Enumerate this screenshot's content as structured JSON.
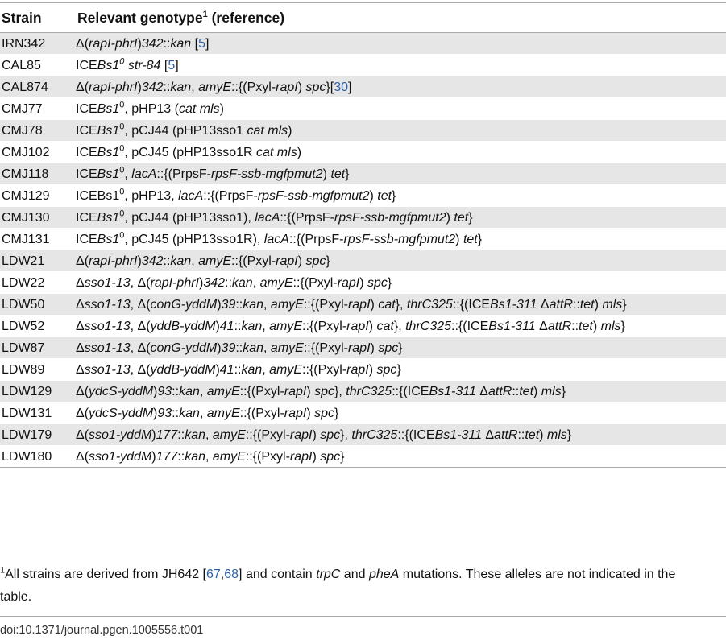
{
  "headers": {
    "strain": "Strain",
    "genotype": "Relevant genotype",
    "genotype_sup": "1",
    "genotype_suffix": "(reference)"
  },
  "rows": [
    {
      "strain": "IRN342",
      "genotype": [
        {
          "t": "Δ("
        },
        {
          "t": "rapI-phrI",
          "i": true
        },
        {
          "t": ")"
        },
        {
          "t": "342",
          "i": true
        },
        {
          "t": "::"
        },
        {
          "t": "kan",
          "i": true
        },
        {
          "t": " ["
        },
        {
          "t": "5",
          "ref": true
        },
        {
          "t": "]"
        }
      ]
    },
    {
      "strain": "CAL85",
      "genotype": [
        {
          "t": "ICE"
        },
        {
          "t": "Bs1",
          "i": true
        },
        {
          "t": "0",
          "sup": true,
          "i": true
        },
        {
          "t": " "
        },
        {
          "t": "str-84",
          "i": true
        },
        {
          "t": " ["
        },
        {
          "t": "5",
          "ref": true
        },
        {
          "t": "]"
        }
      ]
    },
    {
      "strain": "CAL874",
      "genotype": [
        {
          "t": "Δ("
        },
        {
          "t": "rapI-phrI",
          "i": true
        },
        {
          "t": ")"
        },
        {
          "t": "342",
          "i": true
        },
        {
          "t": "::"
        },
        {
          "t": "kan",
          "i": true
        },
        {
          "t": ", "
        },
        {
          "t": "amyE",
          "i": true
        },
        {
          "t": "::{(Pxyl-"
        },
        {
          "t": "rapI",
          "i": true
        },
        {
          "t": ") "
        },
        {
          "t": "spc",
          "i": true
        },
        {
          "t": "}["
        },
        {
          "t": "30",
          "ref": true
        },
        {
          "t": "]"
        }
      ]
    },
    {
      "strain": "CMJ77",
      "genotype": [
        {
          "t": "ICE"
        },
        {
          "t": "Bs1",
          "i": true
        },
        {
          "t": "0",
          "sup": true
        },
        {
          "t": ", pHP13 ("
        },
        {
          "t": "cat mls",
          "i": true
        },
        {
          "t": ")"
        }
      ]
    },
    {
      "strain": "CMJ78",
      "genotype": [
        {
          "t": "ICE"
        },
        {
          "t": "Bs1",
          "i": true
        },
        {
          "t": "0",
          "sup": true
        },
        {
          "t": ", pCJ44 (pHP13sso1 "
        },
        {
          "t": "cat mls",
          "i": true
        },
        {
          "t": ")"
        }
      ]
    },
    {
      "strain": "CMJ102",
      "genotype": [
        {
          "t": "ICE"
        },
        {
          "t": "Bs1",
          "i": true
        },
        {
          "t": "0",
          "sup": true
        },
        {
          "t": ", pCJ45 (pHP13sso1R "
        },
        {
          "t": "cat mls",
          "i": true
        },
        {
          "t": ")"
        }
      ]
    },
    {
      "strain": "CMJ118",
      "genotype": [
        {
          "t": "ICE"
        },
        {
          "t": "Bs1",
          "i": true
        },
        {
          "t": "0",
          "sup": true
        },
        {
          "t": ", "
        },
        {
          "t": "lacA",
          "i": true
        },
        {
          "t": "::{(PrpsF-"
        },
        {
          "t": "rpsF-ssb-mgfpmut2",
          "i": true
        },
        {
          "t": ") "
        },
        {
          "t": "tet",
          "i": true
        },
        {
          "t": "}"
        }
      ]
    },
    {
      "strain": "CMJ129",
      "genotype": [
        {
          "t": "ICEBs1"
        },
        {
          "t": "0",
          "sup": true
        },
        {
          "t": ", pHP13, "
        },
        {
          "t": "lacA",
          "i": true
        },
        {
          "t": "::{(PrpsF-"
        },
        {
          "t": "rpsF-ssb-mgfpmut2",
          "i": true
        },
        {
          "t": ") "
        },
        {
          "t": "tet",
          "i": true
        },
        {
          "t": "}"
        }
      ]
    },
    {
      "strain": "CMJ130",
      "genotype": [
        {
          "t": "ICE"
        },
        {
          "t": "Bs1",
          "i": true
        },
        {
          "t": "0",
          "sup": true
        },
        {
          "t": ", pCJ44 (pHP13sso1), "
        },
        {
          "t": "lacA",
          "i": true
        },
        {
          "t": "::{(PrpsF-"
        },
        {
          "t": "rpsF-ssb-mgfpmut2",
          "i": true
        },
        {
          "t": ") "
        },
        {
          "t": "tet",
          "i": true
        },
        {
          "t": "}"
        }
      ]
    },
    {
      "strain": "CMJ131",
      "genotype": [
        {
          "t": "ICE"
        },
        {
          "t": "Bs1",
          "i": true
        },
        {
          "t": "0",
          "sup": true
        },
        {
          "t": ", pCJ45 (pHP13sso1R), "
        },
        {
          "t": "lacA",
          "i": true
        },
        {
          "t": "::{(PrpsF-"
        },
        {
          "t": "rpsF-ssb-mgfpmut2",
          "i": true
        },
        {
          "t": ") "
        },
        {
          "t": "tet",
          "i": true
        },
        {
          "t": "}"
        }
      ]
    },
    {
      "strain": "LDW21",
      "genotype": [
        {
          "t": "Δ("
        },
        {
          "t": "rapI-phrI",
          "i": true
        },
        {
          "t": ")"
        },
        {
          "t": "342",
          "i": true
        },
        {
          "t": "::"
        },
        {
          "t": "kan",
          "i": true
        },
        {
          "t": ", "
        },
        {
          "t": "amyE",
          "i": true
        },
        {
          "t": "::{(Pxyl-"
        },
        {
          "t": "rapI",
          "i": true
        },
        {
          "t": ") "
        },
        {
          "t": "spc",
          "i": true
        },
        {
          "t": "}"
        }
      ]
    },
    {
      "strain": "LDW22",
      "genotype": [
        {
          "t": "Δ"
        },
        {
          "t": "sso1-13",
          "i": true
        },
        {
          "t": ", Δ("
        },
        {
          "t": "rapI-phrI",
          "i": true
        },
        {
          "t": ")"
        },
        {
          "t": "342",
          "i": true
        },
        {
          "t": "::"
        },
        {
          "t": "kan",
          "i": true
        },
        {
          "t": ", "
        },
        {
          "t": "amyE",
          "i": true
        },
        {
          "t": "::{(Pxyl-"
        },
        {
          "t": "rapI",
          "i": true
        },
        {
          "t": ") "
        },
        {
          "t": "spc",
          "i": true
        },
        {
          "t": "}"
        }
      ]
    },
    {
      "strain": "LDW50",
      "genotype": [
        {
          "t": "Δ"
        },
        {
          "t": "sso1-13",
          "i": true
        },
        {
          "t": ", Δ("
        },
        {
          "t": "conG-yddM",
          "i": true
        },
        {
          "t": ")"
        },
        {
          "t": "39",
          "i": true
        },
        {
          "t": "::"
        },
        {
          "t": "kan",
          "i": true
        },
        {
          "t": ", "
        },
        {
          "t": "amyE",
          "i": true
        },
        {
          "t": "::{(Pxyl-"
        },
        {
          "t": "rapI",
          "i": true
        },
        {
          "t": ") "
        },
        {
          "t": "cat",
          "i": true
        },
        {
          "t": "}, "
        },
        {
          "t": "thrC325",
          "i": true
        },
        {
          "t": "::{(ICE"
        },
        {
          "t": "Bs1-311",
          "i": true
        },
        {
          "t": " Δ"
        },
        {
          "t": "attR",
          "i": true
        },
        {
          "t": "::"
        },
        {
          "t": "tet",
          "i": true
        },
        {
          "t": ") "
        },
        {
          "t": "mls",
          "i": true
        },
        {
          "t": "}"
        }
      ]
    },
    {
      "strain": "LDW52",
      "genotype": [
        {
          "t": "Δ"
        },
        {
          "t": "sso1-13",
          "i": true
        },
        {
          "t": ", Δ("
        },
        {
          "t": "yddB-yddM",
          "i": true
        },
        {
          "t": ")"
        },
        {
          "t": "41",
          "i": true
        },
        {
          "t": "::"
        },
        {
          "t": "kan",
          "i": true
        },
        {
          "t": ", "
        },
        {
          "t": "amyE",
          "i": true
        },
        {
          "t": "::{(Pxyl-"
        },
        {
          "t": "rapI",
          "i": true
        },
        {
          "t": ") "
        },
        {
          "t": "cat",
          "i": true
        },
        {
          "t": "}, "
        },
        {
          "t": "thrC325",
          "i": true
        },
        {
          "t": "::{(ICE"
        },
        {
          "t": "Bs1-311",
          "i": true
        },
        {
          "t": " Δ"
        },
        {
          "t": "attR",
          "i": true
        },
        {
          "t": "::"
        },
        {
          "t": "tet",
          "i": true
        },
        {
          "t": ") "
        },
        {
          "t": "mls",
          "i": true
        },
        {
          "t": "}"
        }
      ]
    },
    {
      "strain": "LDW87",
      "genotype": [
        {
          "t": "Δ"
        },
        {
          "t": "sso1-13",
          "i": true
        },
        {
          "t": ", Δ("
        },
        {
          "t": "conG-yddM",
          "i": true
        },
        {
          "t": ")"
        },
        {
          "t": "39",
          "i": true
        },
        {
          "t": "::"
        },
        {
          "t": "kan",
          "i": true
        },
        {
          "t": ", "
        },
        {
          "t": "amyE",
          "i": true
        },
        {
          "t": "::{(Pxyl-"
        },
        {
          "t": "rapI",
          "i": true
        },
        {
          "t": ") "
        },
        {
          "t": "spc",
          "i": true
        },
        {
          "t": "}"
        }
      ]
    },
    {
      "strain": "LDW89",
      "genotype": [
        {
          "t": "Δ"
        },
        {
          "t": "sso1-13",
          "i": true
        },
        {
          "t": ", Δ("
        },
        {
          "t": "yddB-yddM",
          "i": true
        },
        {
          "t": ")"
        },
        {
          "t": "41",
          "i": true
        },
        {
          "t": "::"
        },
        {
          "t": "kan",
          "i": true
        },
        {
          "t": ", "
        },
        {
          "t": "amyE",
          "i": true
        },
        {
          "t": "::{(Pxyl-"
        },
        {
          "t": "rapI",
          "i": true
        },
        {
          "t": ") "
        },
        {
          "t": "spc",
          "i": true
        },
        {
          "t": "}"
        }
      ]
    },
    {
      "strain": "LDW129",
      "genotype": [
        {
          "t": "Δ("
        },
        {
          "t": "ydcS-yddM",
          "i": true
        },
        {
          "t": ")"
        },
        {
          "t": "93",
          "i": true
        },
        {
          "t": "::"
        },
        {
          "t": "kan",
          "i": true
        },
        {
          "t": ", "
        },
        {
          "t": "amyE",
          "i": true
        },
        {
          "t": "::{(Pxyl-"
        },
        {
          "t": "rapI",
          "i": true
        },
        {
          "t": ") "
        },
        {
          "t": "spc",
          "i": true
        },
        {
          "t": "}, "
        },
        {
          "t": "thrC325",
          "i": true
        },
        {
          "t": "::{(ICE"
        },
        {
          "t": "Bs1-311",
          "i": true
        },
        {
          "t": " Δ"
        },
        {
          "t": "attR",
          "i": true
        },
        {
          "t": "::"
        },
        {
          "t": "tet",
          "i": true
        },
        {
          "t": ") "
        },
        {
          "t": "mls",
          "i": true
        },
        {
          "t": "}"
        }
      ]
    },
    {
      "strain": "LDW131",
      "genotype": [
        {
          "t": "Δ("
        },
        {
          "t": "ydcS-yddM",
          "i": true
        },
        {
          "t": ")"
        },
        {
          "t": "93",
          "i": true
        },
        {
          "t": "::"
        },
        {
          "t": "kan",
          "i": true
        },
        {
          "t": ", "
        },
        {
          "t": "amyE",
          "i": true
        },
        {
          "t": "::{(Pxyl-"
        },
        {
          "t": "rapI",
          "i": true
        },
        {
          "t": ") "
        },
        {
          "t": "spc",
          "i": true
        },
        {
          "t": "}"
        }
      ]
    },
    {
      "strain": "LDW179",
      "genotype": [
        {
          "t": "Δ("
        },
        {
          "t": "sso1-yddM",
          "i": true
        },
        {
          "t": ")"
        },
        {
          "t": "177",
          "i": true
        },
        {
          "t": "::"
        },
        {
          "t": "kan",
          "i": true
        },
        {
          "t": ", "
        },
        {
          "t": "amyE",
          "i": true
        },
        {
          "t": "::{(Pxyl-"
        },
        {
          "t": "rapI",
          "i": true
        },
        {
          "t": ") "
        },
        {
          "t": "spc",
          "i": true
        },
        {
          "t": "}, "
        },
        {
          "t": "thrC325",
          "i": true
        },
        {
          "t": "::{(ICE"
        },
        {
          "t": "Bs1-311",
          "i": true
        },
        {
          "t": " Δ"
        },
        {
          "t": "attR",
          "i": true
        },
        {
          "t": "::"
        },
        {
          "t": "tet",
          "i": true
        },
        {
          "t": ") "
        },
        {
          "t": "mls",
          "i": true
        },
        {
          "t": "}"
        }
      ]
    },
    {
      "strain": "LDW180",
      "genotype": [
        {
          "t": "Δ("
        },
        {
          "t": "sso1-yddM",
          "i": true
        },
        {
          "t": ")"
        },
        {
          "t": "177",
          "i": true
        },
        {
          "t": "::"
        },
        {
          "t": "kan",
          "i": true
        },
        {
          "t": ", "
        },
        {
          "t": "amyE",
          "i": true
        },
        {
          "t": "::{(Pxyl-"
        },
        {
          "t": "rapI",
          "i": true
        },
        {
          "t": ") "
        },
        {
          "t": "spc",
          "i": true
        },
        {
          "t": "}"
        }
      ]
    }
  ],
  "footnote": [
    {
      "t": "1",
      "sup": true
    },
    {
      "t": "All strains are derived from JH642 ["
    },
    {
      "t": "67",
      "ref": true
    },
    {
      "t": ","
    },
    {
      "t": "68",
      "ref": true
    },
    {
      "t": "] and contain "
    },
    {
      "t": "trpC",
      "i": true
    },
    {
      "t": " and "
    },
    {
      "t": "pheA",
      "i": true
    },
    {
      "t": " mutations. These alleles are not indicated in the table."
    }
  ],
  "doi": "doi:10.1371/journal.pgen.1005556.t001",
  "colors": {
    "stripe": "#e6e6e6",
    "rule": "#aaaaaa",
    "ref_link": "#2a5fa8"
  }
}
